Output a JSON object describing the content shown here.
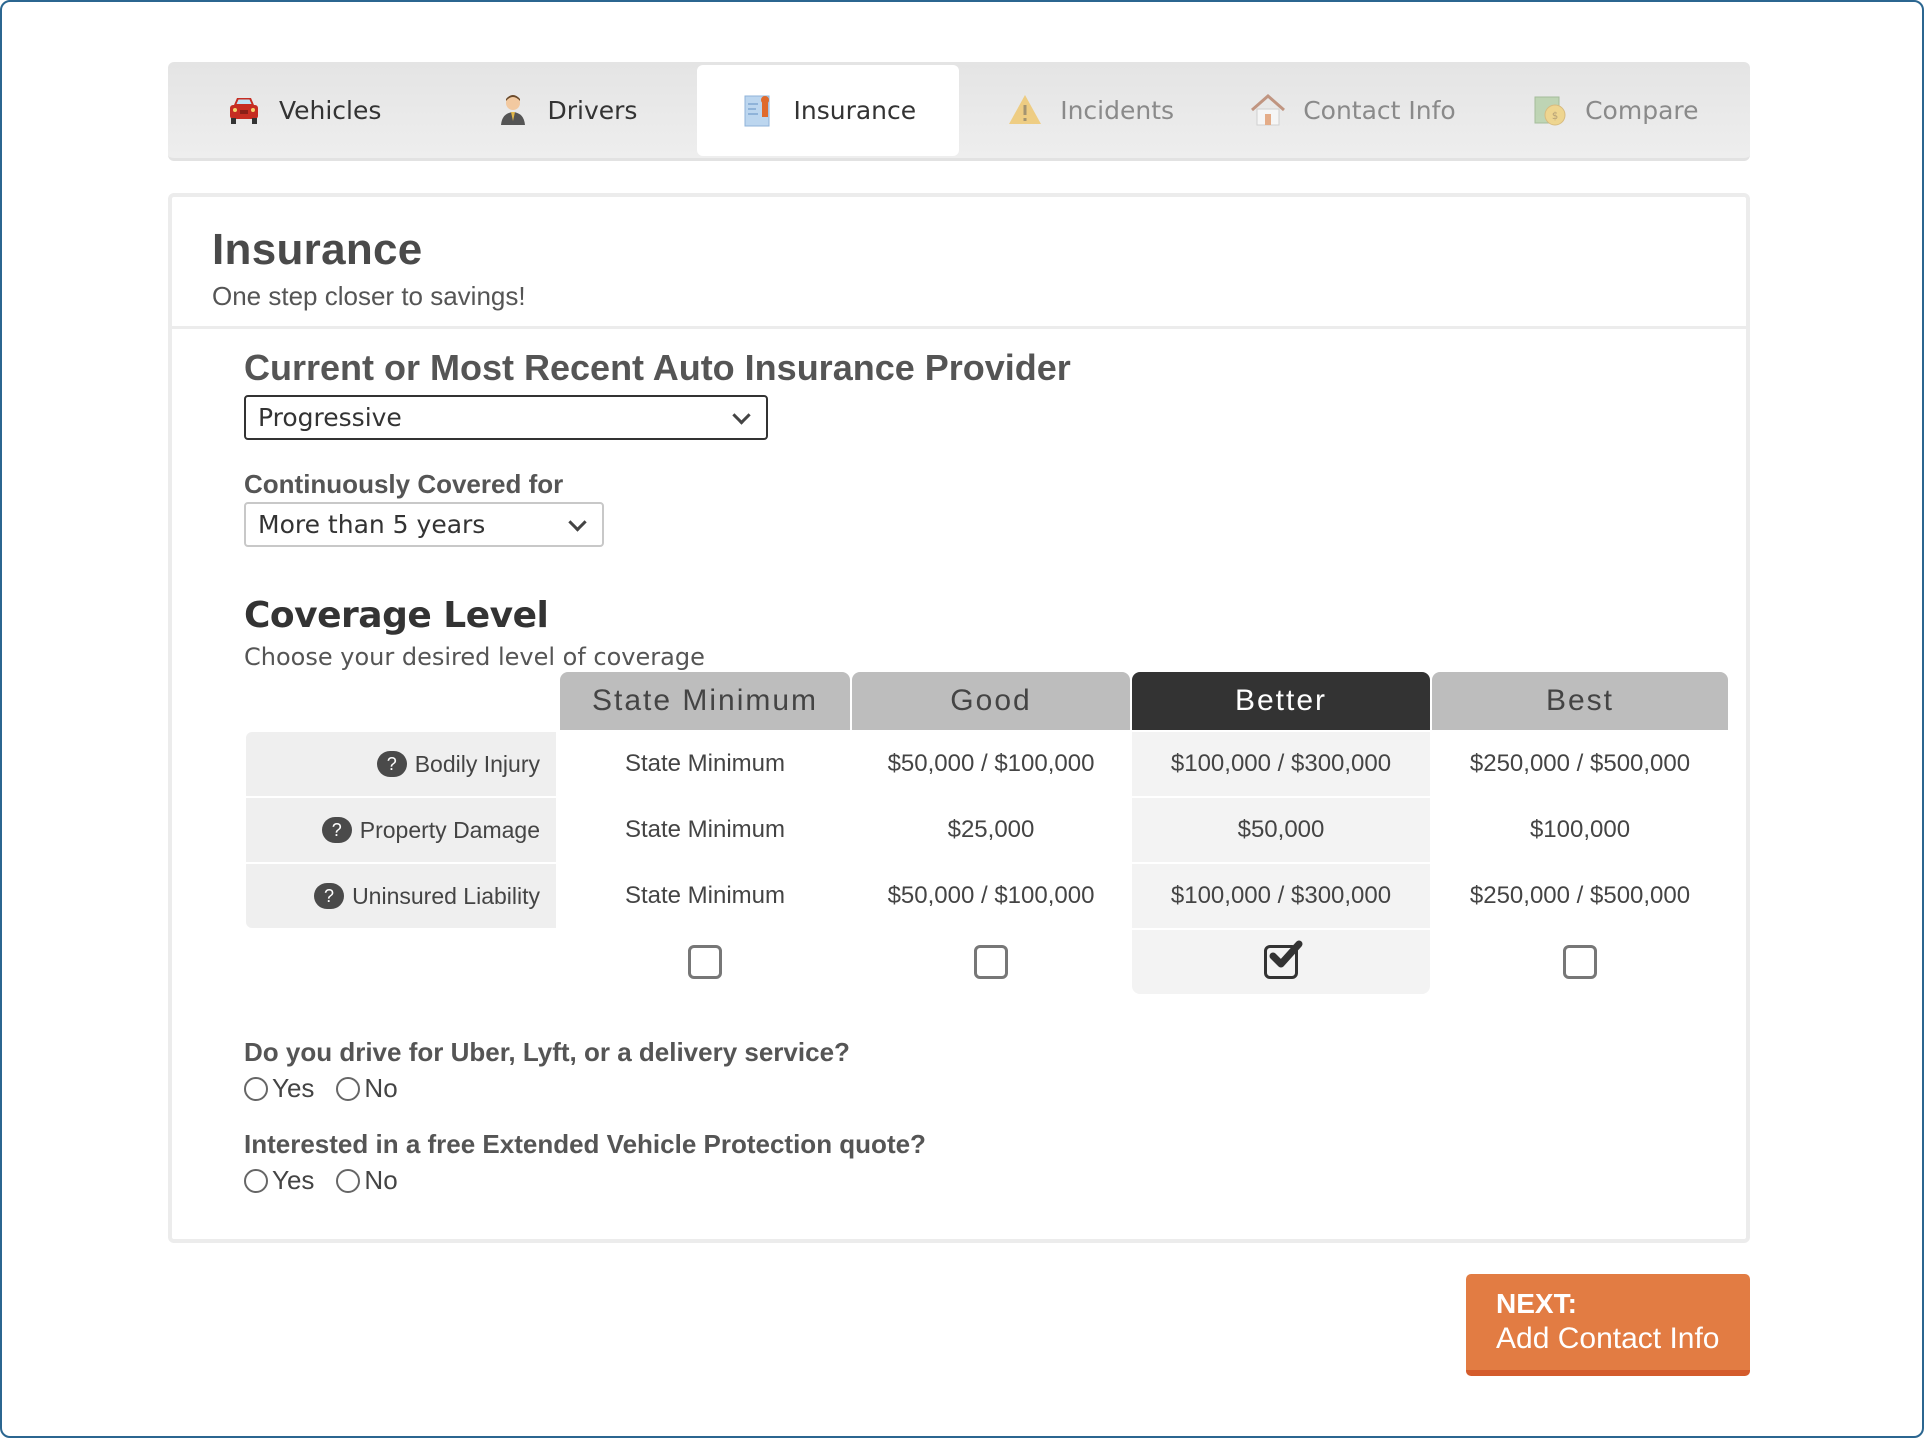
{
  "tabs": [
    {
      "label": "Vehicles",
      "icon": "car-icon",
      "state": "complete"
    },
    {
      "label": "Drivers",
      "icon": "driver-icon",
      "state": "complete"
    },
    {
      "label": "Insurance",
      "icon": "certificate-icon",
      "state": "active"
    },
    {
      "label": "Incidents",
      "icon": "warning-icon",
      "state": "disabled"
    },
    {
      "label": "Contact Info",
      "icon": "house-icon",
      "state": "disabled"
    },
    {
      "label": "Compare",
      "icon": "money-icon",
      "state": "disabled"
    }
  ],
  "header": {
    "title": "Insurance",
    "subtitle": "One step closer to savings!"
  },
  "provider": {
    "label": "Current or Most Recent Auto Insurance Provider",
    "value": "Progressive"
  },
  "covered": {
    "label": "Continuously Covered for",
    "value": "More than 5 years"
  },
  "coverage": {
    "title": "Coverage Level",
    "subtitle": "Choose your desired level of coverage",
    "selected_level": "Better",
    "levels": [
      "State Minimum",
      "Good",
      "Better",
      "Best"
    ],
    "rows": [
      {
        "label": "Bodily Injury",
        "values": [
          "State Minimum",
          "$50,000 / $100,000",
          "$100,000 / $300,000",
          "$250,000 / $500,000"
        ]
      },
      {
        "label": "Property Damage",
        "values": [
          "State Minimum",
          "$25,000",
          "$50,000",
          "$100,000"
        ]
      },
      {
        "label": "Uninsured Liability",
        "values": [
          "State Minimum",
          "$50,000 / $100,000",
          "$100,000 / $300,000",
          "$250,000 / $500,000"
        ]
      }
    ],
    "help_glyph": "?",
    "checked": [
      false,
      false,
      true,
      false
    ]
  },
  "questions": [
    {
      "text": "Do you drive for Uber, Lyft, or a delivery service?",
      "options": [
        "Yes",
        "No"
      ],
      "selected": null
    },
    {
      "text": "Interested in a free Extended Vehicle Protection quote?",
      "options": [
        "Yes",
        "No"
      ],
      "selected": null
    }
  ],
  "next_button": {
    "line1": "NEXT:",
    "line2": "Add Contact Info"
  },
  "colors": {
    "frame_border": "#2b6690",
    "next_bg": "#e27c43",
    "next_border": "#d45c2c",
    "selected_header": "#333333",
    "header_bg": "#bdbdbd"
  }
}
